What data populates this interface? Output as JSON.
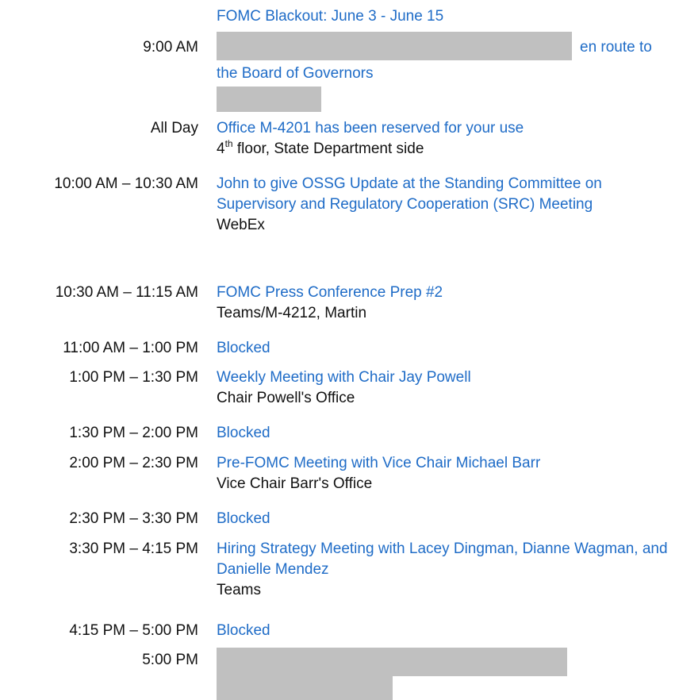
{
  "blackout": "FOMC Blackout: June 3 - June 15",
  "events": [
    {
      "time": "9:00 AM",
      "title_tail": "en route to",
      "title_next": "the Board of Governors"
    },
    {
      "time": "All Day",
      "title": "Office M-4201 has been reserved for your use",
      "loc_num": "4",
      "loc_sup": "th",
      "loc_rest": " floor, State Department side"
    },
    {
      "time": "10:00 AM – 10:30 AM",
      "title": "John to give OSSG Update at the Standing Committee on Supervisory and Regulatory Cooperation (SRC) Meeting",
      "loc": "WebEx"
    },
    {
      "time": "10:30 AM – 11:15 AM",
      "title": "FOMC Press Conference Prep #2",
      "loc": "Teams/M-4212, Martin"
    },
    {
      "time": "11:00 AM – 1:00 PM",
      "title": "Blocked"
    },
    {
      "time": "1:00 PM – 1:30 PM",
      "title": "Weekly Meeting with Chair Jay Powell",
      "loc": "Chair Powell's Office"
    },
    {
      "time": "1:30 PM – 2:00 PM",
      "title": "Blocked"
    },
    {
      "time": "2:00 PM – 2:30 PM",
      "title": "Pre-FOMC Meeting with Vice Chair Michael Barr",
      "loc": "Vice Chair Barr's Office"
    },
    {
      "time": "2:30 PM – 3:30 PM",
      "title": "Blocked"
    },
    {
      "time": "3:30 PM – 4:15 PM",
      "title": "Hiring Strategy Meeting with Lacey Dingman, Dianne Wagman, and Danielle Mendez",
      "loc": "Teams"
    },
    {
      "time": "4:15 PM – 5:00 PM",
      "title": "Blocked"
    },
    {
      "time": "5:00 PM"
    }
  ]
}
